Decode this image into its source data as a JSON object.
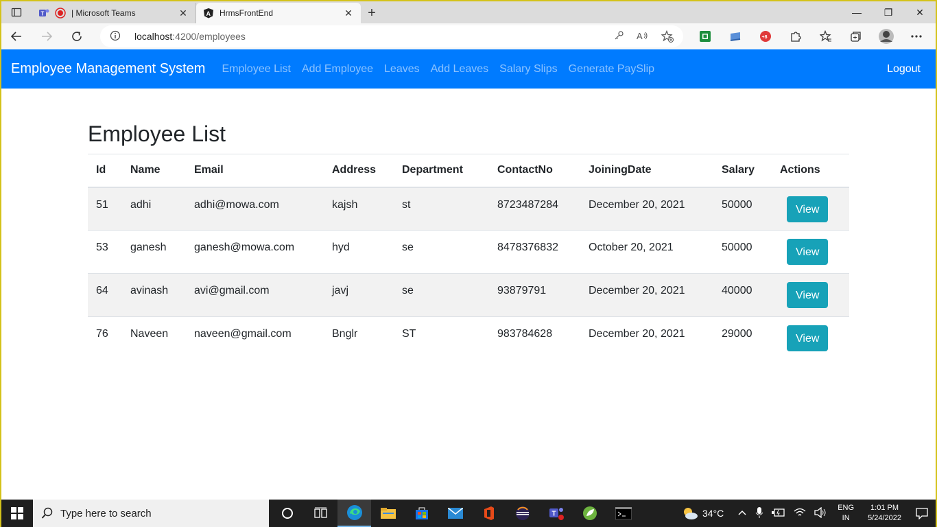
{
  "browser": {
    "tabs": [
      {
        "title": "| Microsoft Teams",
        "active": false
      },
      {
        "title": "HrmsFrontEnd",
        "active": true
      }
    ],
    "address": {
      "host": "localhost",
      "path": ":4200/employees"
    }
  },
  "navbar": {
    "brand": "Employee Management System",
    "links": [
      "Employee List",
      "Add Employee",
      "Leaves",
      "Add Leaves",
      "Salary Slips",
      "Generate PaySlip"
    ],
    "logout": "Logout",
    "color": "#007bff"
  },
  "page": {
    "heading": "Employee List",
    "columns": [
      "Id",
      "Name",
      "Email",
      "Address",
      "Department",
      "ContactNo",
      "JoiningDate",
      "Salary",
      "Actions"
    ],
    "rows": [
      {
        "id": "51",
        "name": "adhi",
        "email": "adhi@mowa.com",
        "address": "kajsh",
        "department": "st",
        "contact": "8723487284",
        "joining": "December 20, 2021",
        "salary": "50000",
        "action": "View"
      },
      {
        "id": "53",
        "name": "ganesh",
        "email": "ganesh@mowa.com",
        "address": "hyd",
        "department": "se",
        "contact": "8478376832",
        "joining": "October 20, 2021",
        "salary": "50000",
        "action": "View"
      },
      {
        "id": "64",
        "name": "avinash",
        "email": "avi@gmail.com",
        "address": "javj",
        "department": "se",
        "contact": "93879791",
        "joining": "December 20, 2021",
        "salary": "40000",
        "action": "View"
      },
      {
        "id": "76",
        "name": "Naveen",
        "email": "naveen@gmail.com",
        "address": "Bnglr",
        "department": "ST",
        "contact": "983784628",
        "joining": "December 20, 2021",
        "salary": "29000",
        "action": "View"
      }
    ],
    "button_color": "#17a2b8"
  },
  "taskbar": {
    "search_placeholder": "Type here to search",
    "weather": "34°C",
    "lang_top": "ENG",
    "lang_bottom": "IN",
    "time": "1:01 PM",
    "date": "5/24/2022"
  }
}
